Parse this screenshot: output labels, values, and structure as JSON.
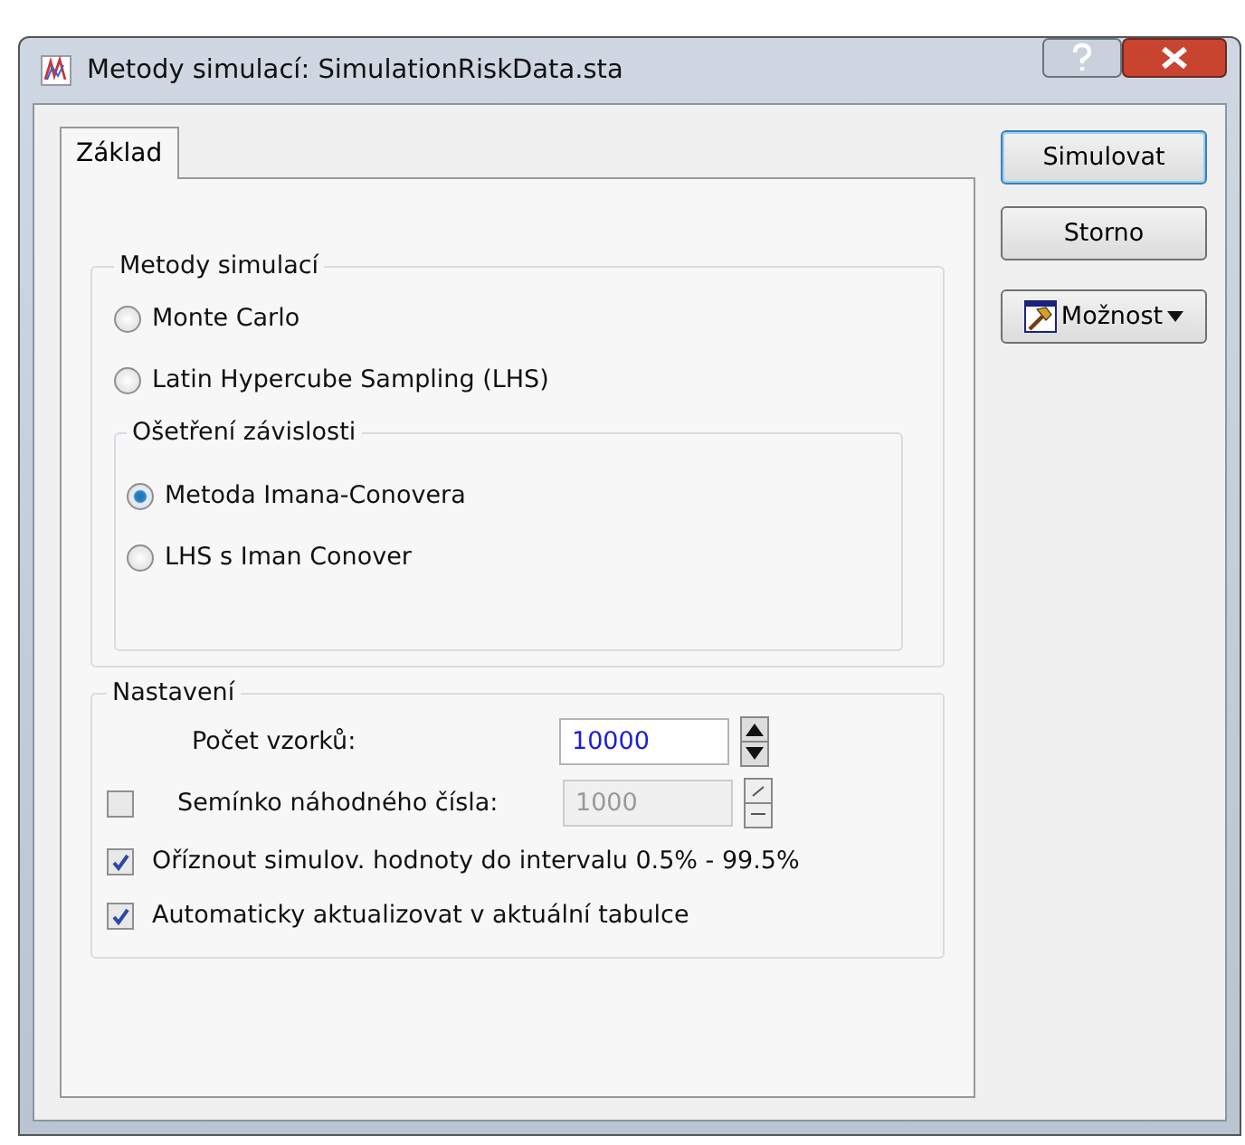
{
  "window": {
    "title": "Metody simulací: SimulationRiskData.sta"
  },
  "tabs": [
    {
      "label": "Základ",
      "selected": true
    }
  ],
  "methods": {
    "title": "Metody simulací",
    "options": [
      {
        "label": "Monte Carlo",
        "selected": false
      },
      {
        "label": "Latin Hypercube Sampling (LHS)",
        "selected": false
      }
    ]
  },
  "dependence": {
    "title": "Ošetření závislosti",
    "options": [
      {
        "label": "Metoda Imana-Conovera",
        "selected": true
      },
      {
        "label": "LHS s Iman Conover",
        "selected": false
      }
    ]
  },
  "settings": {
    "title": "Nastavení",
    "samples": {
      "label": "Počet vzorků:",
      "value": "10000",
      "disabled": false
    },
    "seed": {
      "label": "Semínko náhodného čísla:",
      "value": "1000",
      "disabled": true,
      "checked": false
    },
    "checks": [
      {
        "label": "Oříznout simulov. hodnoty do intervalu 0.5% - 99.5%",
        "checked": true
      },
      {
        "label": "Automaticky aktualizovat v aktuální tabulce",
        "checked": true
      }
    ]
  },
  "buttons": [
    {
      "label": "Simulovat",
      "kind": "default"
    },
    {
      "label": "Storno",
      "kind": "plain"
    },
    {
      "label": "Možnost",
      "kind": "menu"
    }
  ]
}
